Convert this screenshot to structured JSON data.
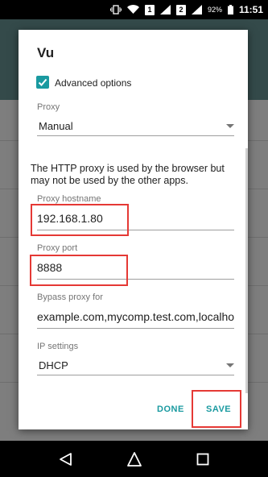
{
  "status_bar": {
    "sim1": "1",
    "sim2": "2",
    "battery": "92%",
    "time": "11:51"
  },
  "dialog": {
    "title": "Vu",
    "advanced_options": {
      "label": "Advanced options",
      "checked": true
    },
    "proxy": {
      "label": "Proxy",
      "value": "Manual"
    },
    "proxy_note": "The HTTP proxy is used by the browser but may not be used by the other apps.",
    "proxy_hostname": {
      "label": "Proxy hostname",
      "value": "192.168.1.80"
    },
    "proxy_port": {
      "label": "Proxy port",
      "value": "8888"
    },
    "bypass": {
      "label": "Bypass proxy for",
      "value": "example.com,mycomp.test.com,localhost"
    },
    "ip_settings": {
      "label": "IP settings",
      "value": "DHCP"
    },
    "buttons": {
      "done": "DONE",
      "save": "SAVE"
    }
  },
  "colors": {
    "accent": "#1a9aa0",
    "highlight": "#e53935"
  },
  "icons": [
    "vibrate-icon",
    "wifi-icon",
    "signal-icon",
    "battery-icon",
    "back-icon",
    "home-icon",
    "recents-icon"
  ]
}
